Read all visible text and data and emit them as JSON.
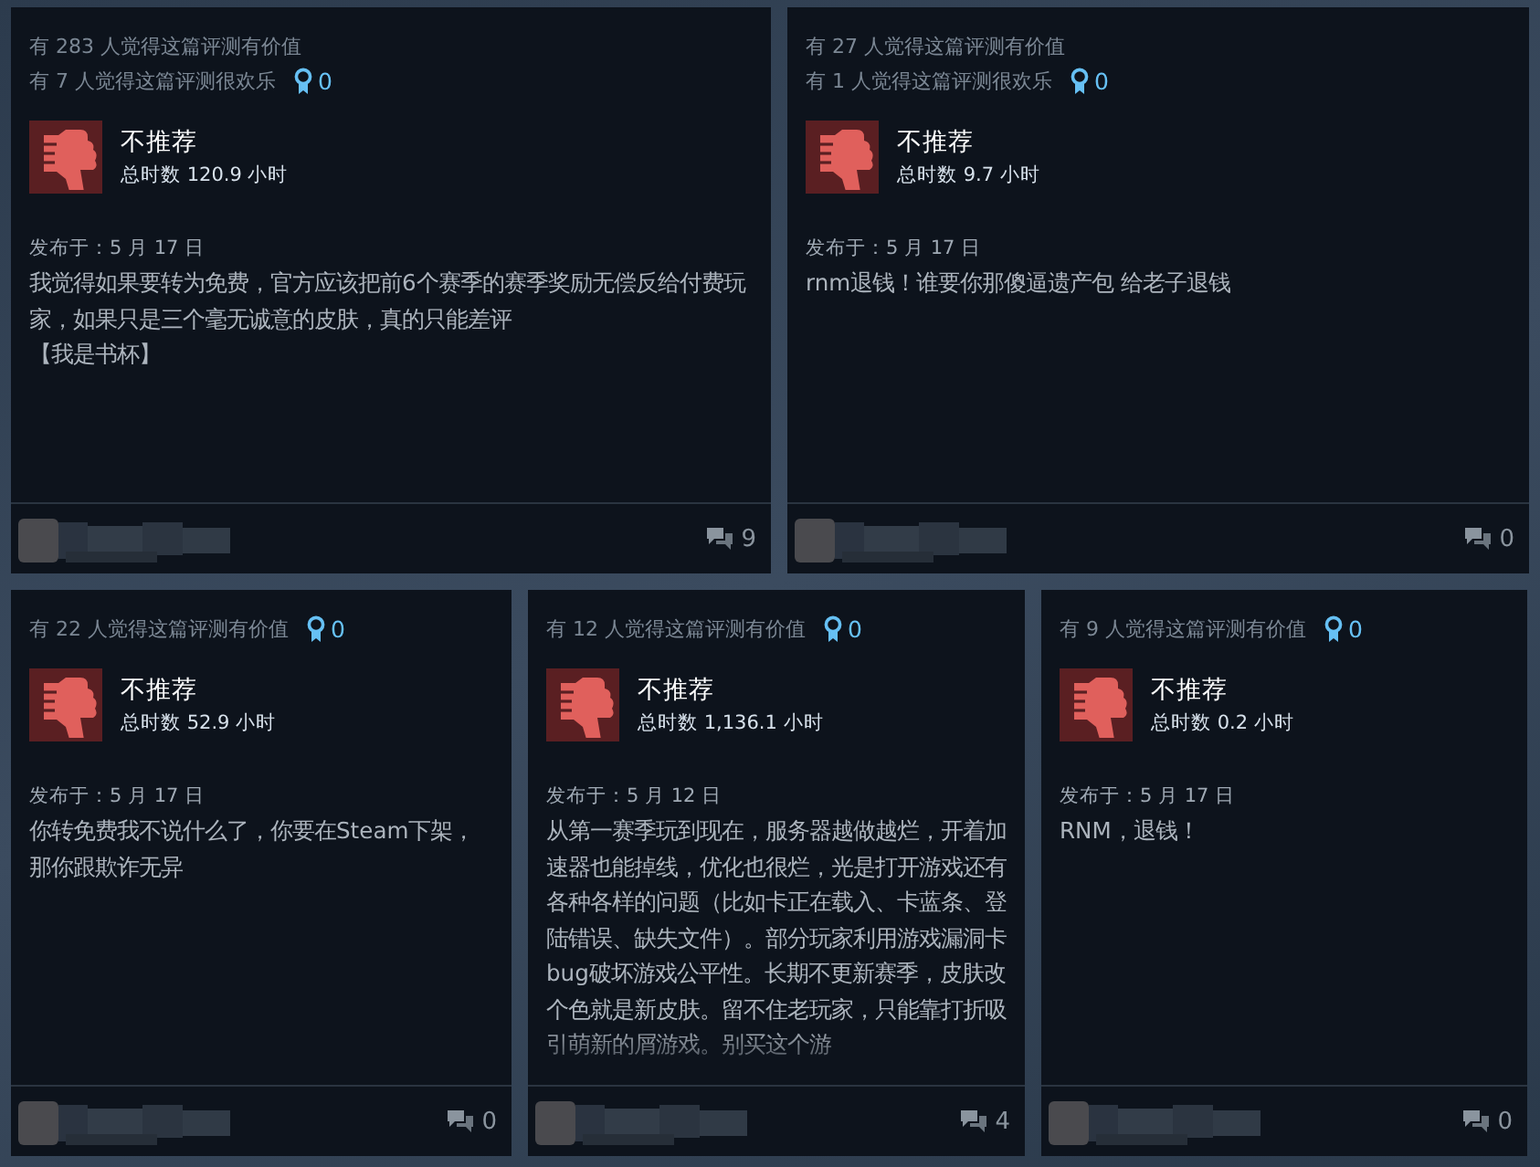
{
  "rows": [
    {
      "reviews": [
        {
          "helpful": "有 283 人觉得这篇评测有价值",
          "funny": "有 7 人觉得这篇评测很欢乐",
          "awards": "0",
          "recommended": false,
          "verdict": "不推荐",
          "hours": "总时数 120.9 小时",
          "posted": "发布于：5 月 17 日",
          "body": [
            "我觉得如果要转为免费，官方应该把前6个赛季的赛季奖励无偿反给付费玩家，如果只是三个毫无诚意的皮肤，真的只能差评",
            "【我是书杯】"
          ],
          "faded": false,
          "comments": "9"
        },
        {
          "helpful": "有 27 人觉得这篇评测有价值",
          "funny": "有 1 人觉得这篇评测很欢乐",
          "awards": "0",
          "recommended": false,
          "verdict": "不推荐",
          "hours": "总时数 9.7 小时",
          "posted": "发布于：5 月 17 日",
          "body": [
            "rnm退钱！谁要你那傻逼遗产包 给老子退钱"
          ],
          "faded": false,
          "comments": "0"
        }
      ]
    },
    {
      "reviews": [
        {
          "helpful": "有 22 人觉得这篇评测有价值",
          "awards": "0",
          "recommended": false,
          "verdict": "不推荐",
          "hours": "总时数 52.9 小时",
          "posted": "发布于：5 月 17 日",
          "body": [
            "你转免费我不说什么了，你要在Steam下架，那你跟欺诈无异"
          ],
          "faded": false,
          "comments": "0"
        },
        {
          "helpful": "有 12 人觉得这篇评测有价值",
          "awards": "0",
          "recommended": false,
          "verdict": "不推荐",
          "hours": "总时数 1,136.1 小时",
          "posted": "发布于：5 月 12 日",
          "body": [
            "从第一赛季玩到现在，服务器越做越烂，开着加速器也能掉线，优化也很烂，光是打开游戏还有各种各样的问题（比如卡正在载入、卡蓝条、登陆错误、缺失文件）。部分玩家利用游戏漏洞卡bug破坏游戏公平性。长期不更新赛季，皮肤改个色就是新皮肤。留不住老玩家，只能靠打折吸引萌新的屑游戏。别买这个游"
          ],
          "faded": true,
          "comments": "4"
        },
        {
          "helpful": "有 9 人觉得这篇评测有价值",
          "awards": "0",
          "recommended": false,
          "verdict": "不推荐",
          "hours": "总时数 0.2 小时",
          "posted": "发布于：5 月 17 日",
          "body": [
            "RNM，退钱！"
          ],
          "faded": false,
          "comments": "0"
        }
      ]
    }
  ]
}
